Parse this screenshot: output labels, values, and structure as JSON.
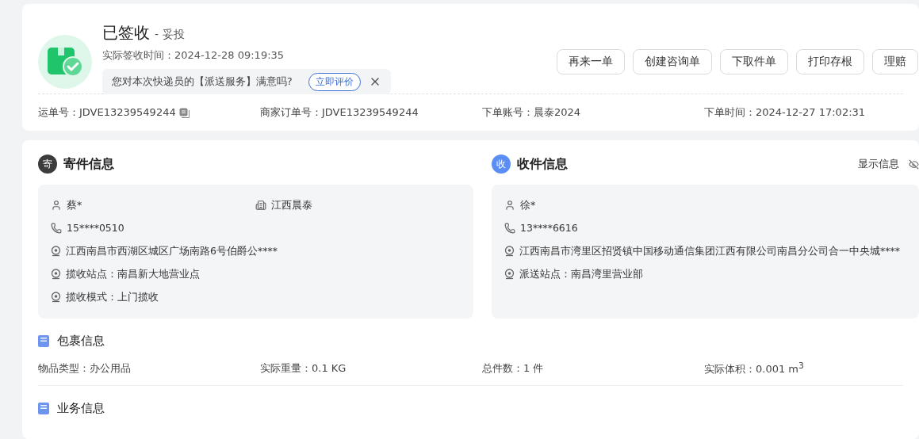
{
  "status": {
    "title": "已签收",
    "subtitle": "- 妥投",
    "sign_time_label": "实际签收时间：",
    "sign_time": "2024-12-28 09:19:35"
  },
  "feedback": {
    "text": "您对本次快递员的【派送服务】满意吗?",
    "button": "立即评价"
  },
  "actions": [
    "再来一单",
    "创建咨询单",
    "下取件单",
    "打印存根",
    "理赔"
  ],
  "order_info": [
    {
      "label": "运单号：",
      "value": "JDVE13239549244",
      "copyable": true
    },
    {
      "label": "商家订单号：",
      "value": "JDVE13239549244",
      "copyable": false
    },
    {
      "label": "下单账号：",
      "value": "晨泰2024",
      "copyable": false
    },
    {
      "label": "下单时间：",
      "value": "2024-12-27 17:02:31",
      "copyable": false
    }
  ],
  "sender": {
    "badge": "寄",
    "color": "#3d3d3d",
    "title": "寄件信息",
    "rows": [
      [
        {
          "kind": "person",
          "text": "蔡*"
        },
        {
          "kind": "company",
          "text": "江西晨泰"
        }
      ],
      [
        {
          "kind": "phone",
          "text": "15****0510"
        }
      ],
      [
        {
          "kind": "location",
          "text": "江西南昌市西湖区城区广场南路6号伯爵公****"
        }
      ],
      [
        {
          "kind": "location",
          "text": "揽收站点：南昌新大地营业点"
        }
      ],
      [
        {
          "kind": "location",
          "text": "揽收模式：上门揽收"
        }
      ]
    ]
  },
  "receiver": {
    "badge": "收",
    "color": "#5b8ef5",
    "title": "收件信息",
    "link": "显示信息",
    "rows": [
      [
        {
          "kind": "person",
          "text": "徐*"
        }
      ],
      [
        {
          "kind": "phone",
          "text": "13****6616"
        }
      ],
      [
        {
          "kind": "location",
          "text": "江西南昌市湾里区招贤镇中国移动通信集团江西有限公司南昌分公司合一中央城****"
        }
      ],
      [
        {
          "kind": "location",
          "text": "派送站点：南昌湾里营业部"
        }
      ]
    ]
  },
  "package": {
    "title": "包裹信息",
    "fields": [
      {
        "label": "物品类型：",
        "value": "办公用品"
      },
      {
        "label": "实际重量：",
        "value": "0.1 KG"
      },
      {
        "label": "总件数：",
        "value": "1 件"
      },
      {
        "label": "实际体积：",
        "value": "0.001 m$^{3}$"
      }
    ]
  },
  "business": {
    "title": "业务信息"
  }
}
